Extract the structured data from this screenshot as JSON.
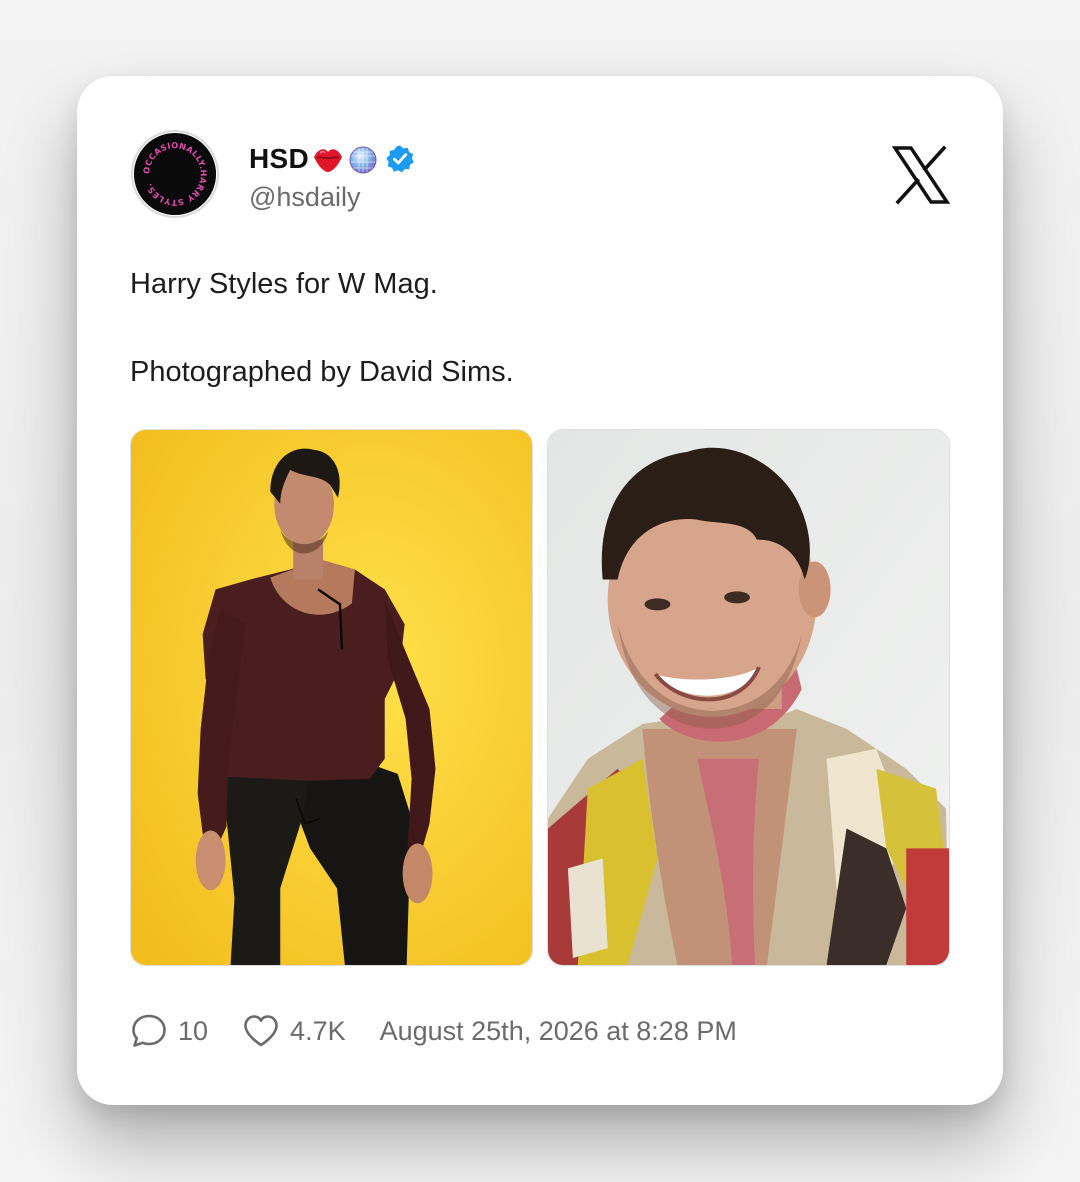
{
  "tweet": {
    "author": {
      "display_name": "HSD",
      "name_emojis": [
        "kiss-mark-emoji",
        "mirror-ball-emoji"
      ],
      "verified": true,
      "handle": "@hsdaily",
      "avatar_ring_text": "OCCASIONALLY.HARRY STYLES."
    },
    "platform_icon": "x-logo-icon",
    "text_lines": [
      "Harry Styles for W Mag.",
      "Photographed by David Sims."
    ],
    "media": [
      {
        "alt": "",
        "background": "#f5c629"
      },
      {
        "alt": "",
        "background": "#e9ebea"
      }
    ],
    "stats": {
      "replies": "10",
      "likes": "4.7K"
    },
    "timestamp": "August 25th, 2026 at 8:28 PM"
  },
  "colors": {
    "verified_badge": "#1d9bf0",
    "text_primary": "#111111",
    "text_secondary": "#6b6b6b",
    "card_background": "#ffffff"
  }
}
